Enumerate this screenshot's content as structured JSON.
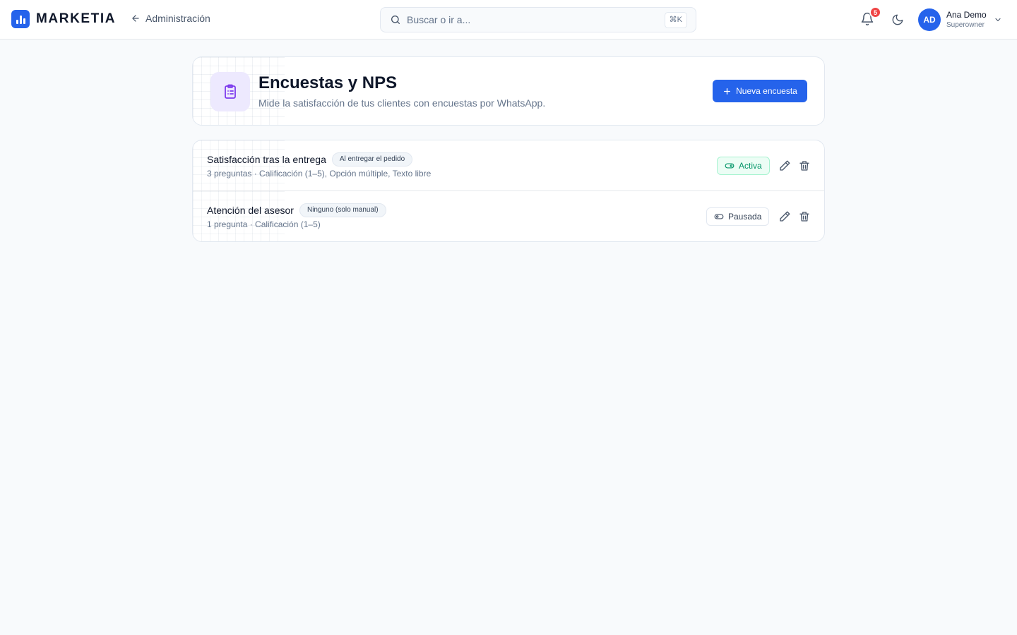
{
  "brand": {
    "name": "MARKETIA"
  },
  "nav": {
    "back_label": "Administración"
  },
  "search": {
    "placeholder": "Buscar o ir a...",
    "shortcut": "⌘K"
  },
  "notifications": {
    "count": "5"
  },
  "user": {
    "initials": "AD",
    "name": "Ana Demo",
    "role": "Superowner"
  },
  "page": {
    "title": "Encuestas y NPS",
    "subtitle": "Mide la satisfacción de tus clientes con encuestas por WhatsApp.",
    "new_button": "Nueva encuesta"
  },
  "surveys": [
    {
      "name": "Satisfacción tras la entrega",
      "trigger": "Al entregar el pedido",
      "summary": "3 preguntas · Calificación (1–5), Opción múltiple, Texto libre",
      "status": "Activa"
    },
    {
      "name": "Atención del asesor",
      "trigger": "Ninguno (solo manual)",
      "summary": "1 pregunta · Calificación (1–5)",
      "status": "Pausada"
    }
  ],
  "colors": {
    "accent": "#2563eb",
    "active": "#059669",
    "badge": "#ef4444",
    "icon_bg": "#ede9fe",
    "icon_fg": "#7c3aed"
  }
}
